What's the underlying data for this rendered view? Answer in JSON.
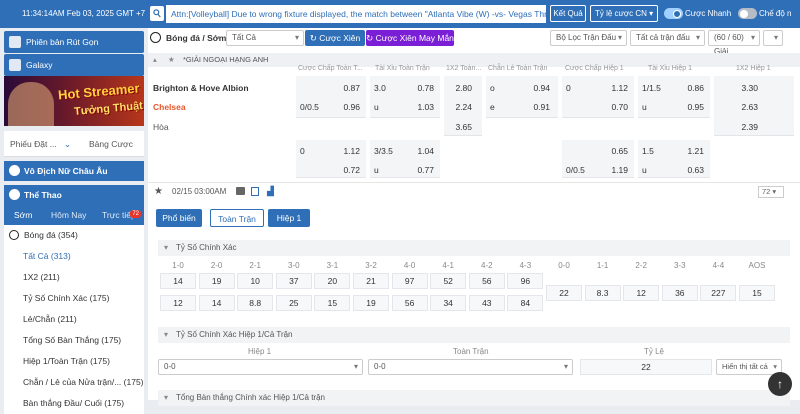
{
  "topbar": {
    "time": "11:34:14AM Feb 03, 2025 GMT +7",
    "announcement": "Attn:[Volleyball] Due to wrong fixture displayed, the match between \"Atlanta Vibe (W) -vs- Vegas Thrill",
    "result_btn": "Kết Quả",
    "odds_type": "Tỷ lệ cược CN",
    "quick_bet": "Cược Nhanh",
    "mode": "Chế độ n"
  },
  "sidebar": {
    "deposit": "Phiên bản Rút Gọn",
    "galaxy": "Galaxy",
    "banner_line1": "Hot Streamer",
    "banner_line2": "Tưởng Thuật",
    "tab_slip": "Phiếu Đặt ...",
    "tab_bets": "Bảng Cược",
    "euro": "Vô Địch Nữ Châu Âu",
    "sports": "Thể Thao",
    "sub_early": "Sớm",
    "sub_today": "Hôm Nay",
    "sub_live": "Trực tiếp",
    "live_count": "72",
    "items": [
      "Bóng đá  (354)",
      "Tất Cả (313)",
      "1X2  (211)",
      "Tỷ Số Chính Xác  (175)",
      "Lẻ/Chẵn  (211)",
      "Tổng Số Bàn Thắng  (175)",
      "Hiệp 1/Toàn Trận  (175)",
      "Chẵn / Lẻ của Nửa trận/...  (175)",
      "Bàn thắng Đầu/ Cuối  (175)"
    ]
  },
  "filters": {
    "sport": "Bóng đá / Sớm",
    "all": "Tất Cả",
    "cuoc_xien": "Cược Xiên",
    "cuoc_xien_may_man": "Cược Xiên May Mắn",
    "league_filter": "Bộ Lọc Trận Đấu",
    "match_filter": "Tất cả trận đấu",
    "count": "(60 / 60) Giải"
  },
  "league": {
    "name": "*GIẢI NGOẠI HẠNG ANH",
    "headers": [
      "Cược Chấp Toàn T...",
      "Tài Xỉu Toàn Trận",
      "1X2 Toàn...",
      "Chẵn Lẻ Toàn Trận",
      "Cược Chấp Hiệp 1",
      "Tài Xỉu Hiệp 1",
      "1X2 Hiệp 1"
    ]
  },
  "match": {
    "home": "Brighton & Hove Albion",
    "away": "Chelsea",
    "draw": "Hòa",
    "r1": {
      "hdp": "",
      "hdp_odds": "0.87",
      "ou_line": "3.0",
      "ou_odds": "0.78",
      "x12": "2.80",
      "oe": "o",
      "oe_odds": "0.94",
      "h1_hdp": "0",
      "h1_hdp_odds": "1.12",
      "h1_ou": "1/1.5",
      "h1_ou_odds": "0.86",
      "h1_x12": "3.30"
    },
    "r2": {
      "hdp": "0/0.5",
      "hdp_odds": "0.96",
      "ou_line": "u",
      "ou_odds": "1.03",
      "x12": "2.24",
      "oe": "e",
      "oe_odds": "0.91",
      "h1_hdp": "",
      "h1_hdp_odds": "0.70",
      "h1_ou": "u",
      "h1_ou_odds": "0.95",
      "h1_x12": "2.63"
    },
    "r3": {
      "x12": "3.65",
      "h1_x12": "2.39"
    },
    "r4": {
      "hdp": "0",
      "hdp_odds": "1.12",
      "ou_line": "3/3.5",
      "ou_odds": "1.04",
      "h1_hdp_odds": "0.65",
      "h1_ou": "1.5",
      "h1_ou_odds": "1.21"
    },
    "r5": {
      "hdp_odds": "0.72",
      "ou_line": "u",
      "ou_odds": "0.77",
      "h1_hdp": "0/0.5",
      "h1_hdp_odds": "1.19",
      "h1_ou": "u",
      "h1_ou_odds": "0.63"
    },
    "datetime": "02/15 03:00AM",
    "more": "72"
  },
  "tabs": [
    "Phổ biến",
    "Toàn Trận",
    "Hiệp 1"
  ],
  "correct_score": {
    "title": "Tỷ Số Chính Xác",
    "labels": [
      "1-0",
      "2-0",
      "2-1",
      "3-0",
      "3-1",
      "3-2",
      "4-0",
      "4-1",
      "4-2",
      "4-3",
      "0-0",
      "1-1",
      "2-2",
      "3-3",
      "4-4",
      "AOS"
    ],
    "row1": [
      "14",
      "19",
      "10",
      "37",
      "20",
      "21",
      "97",
      "52",
      "56",
      "96"
    ],
    "row2": [
      "12",
      "14",
      "8.8",
      "25",
      "15",
      "19",
      "56",
      "34",
      "43",
      "84",
      "22",
      "8.3",
      "12",
      "36",
      "227",
      "15"
    ]
  },
  "htft": {
    "title": "Tỷ Số Chính Xác Hiệp 1/Cả Trận",
    "col1": "Hiệp 1",
    "col2": "Toàn Trận",
    "col3": "Tỷ Lệ",
    "sel1": "0-0",
    "sel2": "0-0",
    "value": "22",
    "show_all": "Hiển thị tất cả"
  },
  "next_section": "Tổng Bàn thắng Chính xác Hiệp 1/Cả trận"
}
